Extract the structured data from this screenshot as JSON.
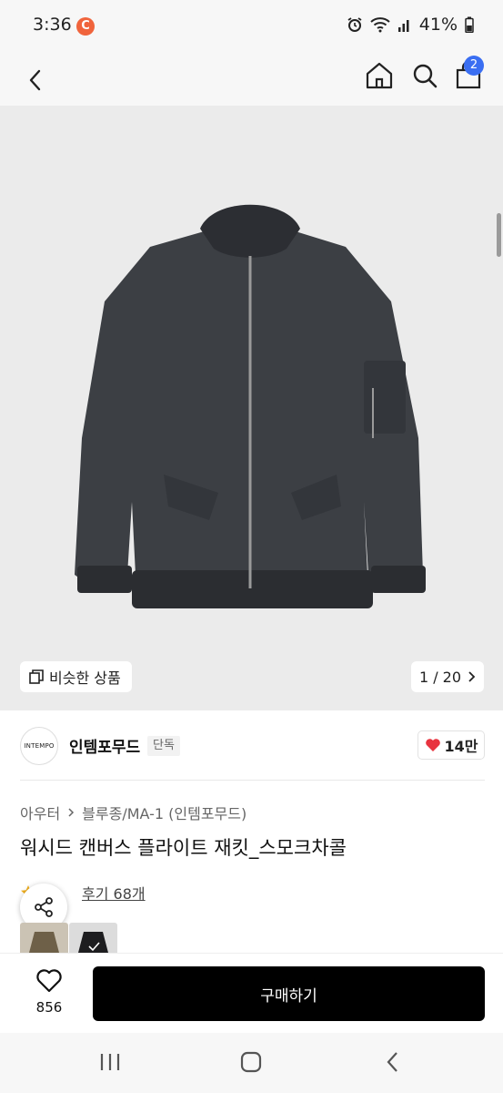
{
  "status_bar": {
    "time": "3:36",
    "app_badge": "C",
    "battery": "41%"
  },
  "nav": {
    "cart_count": "2"
  },
  "hero": {
    "similar_label": "비슷한 상품",
    "pager": "1 / 20"
  },
  "brand": {
    "logo_text": "INTEMPO",
    "name": "인템포무드",
    "tag": "단독",
    "likes": "14만"
  },
  "product": {
    "breadcrumb": [
      "아우터",
      "블루종/MA-1 (인템포무드)"
    ],
    "title": "워시드 캔버스 플라이트 재킷_스모크차콜",
    "review_label": "후기 68개"
  },
  "bottom": {
    "wish_count": "856",
    "buy_label": "구매하기"
  },
  "colors": {
    "accent_blue": "#3a6ef2",
    "heart_red": "#e8343f",
    "jacket": "#3c3f44",
    "buy_button": "#000000"
  }
}
